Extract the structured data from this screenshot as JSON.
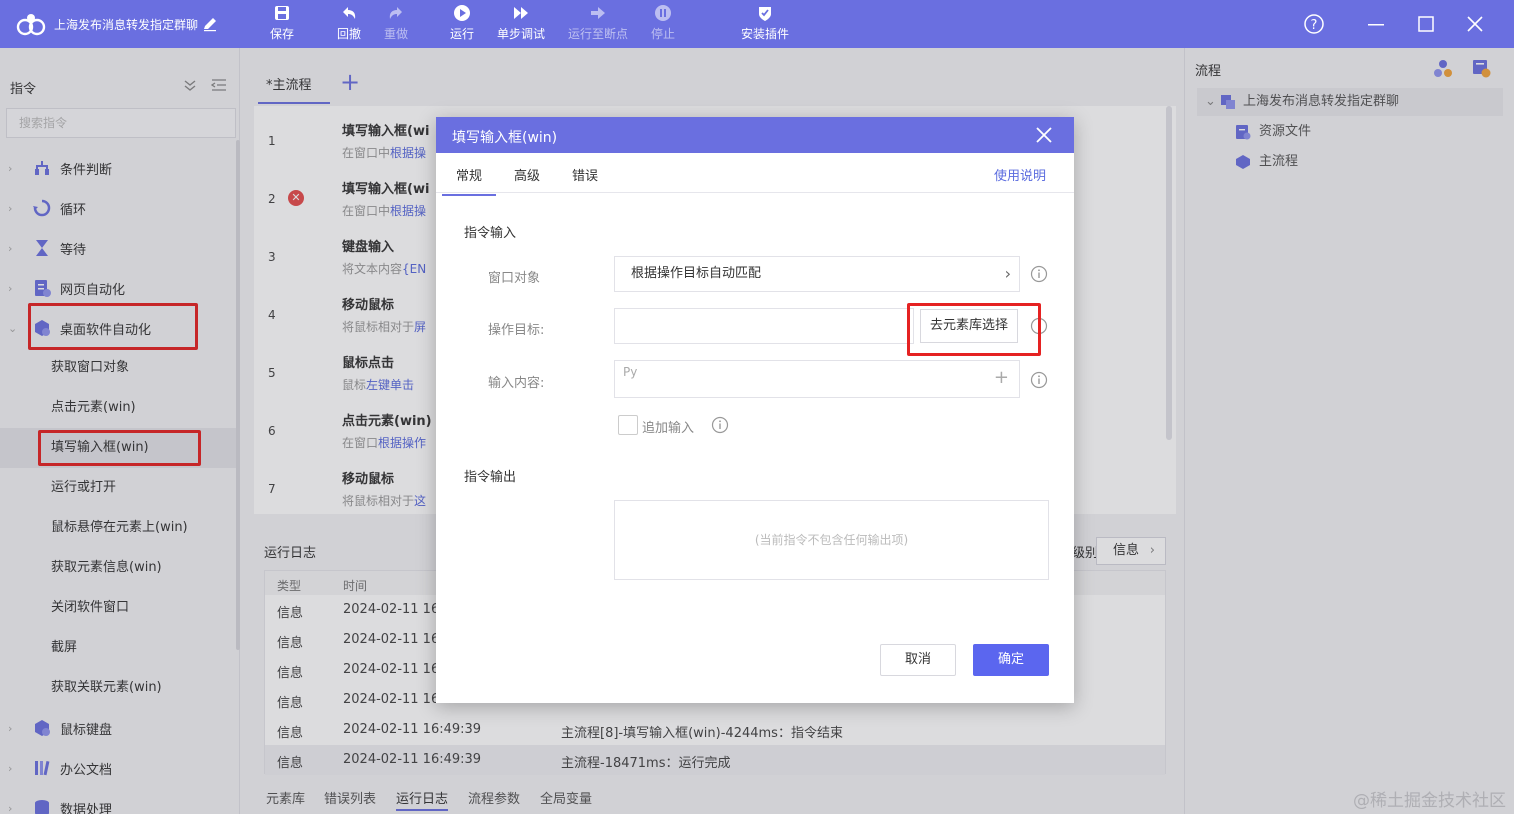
{
  "app": {
    "title": "上海发布消息转发指定群聊"
  },
  "toolbar": {
    "items": [
      {
        "label": "保存",
        "icon": "save-icon"
      },
      {
        "label": "回撤",
        "icon": "undo-icon"
      },
      {
        "label": "重做",
        "icon": "redo-icon"
      },
      {
        "label": "运行",
        "icon": "play-icon"
      },
      {
        "label": "单步调试",
        "icon": "step-debug-icon"
      },
      {
        "label": "运行至断点",
        "icon": "run-to-breakpoint-icon"
      },
      {
        "label": "停止",
        "icon": "stop-icon"
      },
      {
        "label": "安装插件",
        "icon": "plugin-icon"
      }
    ]
  },
  "left": {
    "title": "指令",
    "search_placeholder": "搜索指令",
    "categories": [
      {
        "label": "条件判断"
      },
      {
        "label": "循环"
      },
      {
        "label": "等待"
      },
      {
        "label": "网页自动化"
      },
      {
        "label": "桌面软件自动化"
      },
      {
        "label": "鼠标键盘"
      },
      {
        "label": "办公文档"
      },
      {
        "label": "数据处理"
      }
    ],
    "sub_items": [
      {
        "label": "获取窗口对象"
      },
      {
        "label": "点击元素(win)"
      },
      {
        "label": "填写输入框(win)"
      },
      {
        "label": "运行或打开"
      },
      {
        "label": "鼠标悬停在元素上(win)"
      },
      {
        "label": "获取元素信息(win)"
      },
      {
        "label": "关闭软件窗口"
      },
      {
        "label": "截屏"
      },
      {
        "label": "获取关联元素(win)"
      }
    ]
  },
  "flow": {
    "tab_label": "*主流程",
    "add_tab": "+",
    "rows": [
      {
        "num": "1",
        "title": "填写输入框(wi",
        "desc_prefix": "在窗口中",
        "desc_link": "根据操"
      },
      {
        "num": "2",
        "title": "填写输入框(wi",
        "desc_prefix": "在窗口中",
        "desc_link": "根据操"
      },
      {
        "num": "3",
        "title": "键盘输入",
        "desc_prefix": "将文本内容",
        "desc_link": "{EN"
      },
      {
        "num": "4",
        "title": "移动鼠标",
        "desc_prefix": "将鼠标相对于",
        "desc_link": "屏"
      },
      {
        "num": "5",
        "title": "鼠标点击",
        "desc_prefix": "鼠标",
        "desc_link": "左键单击"
      },
      {
        "num": "6",
        "title": "点击元素(win)",
        "desc_prefix": "在窗口",
        "desc_link": "根据操作"
      },
      {
        "num": "7",
        "title": "移动鼠标",
        "desc_prefix": "将鼠标相对于",
        "desc_link": "这"
      }
    ]
  },
  "log": {
    "title": "运行日志",
    "filter_label": "级别:",
    "filter_value": "信息",
    "columns": [
      "类型",
      "时间"
    ],
    "rows": [
      {
        "type": "信息",
        "time": "2024-02-11 16",
        "msg": ""
      },
      {
        "type": "信息",
        "time": "2024-02-11 16",
        "msg": ""
      },
      {
        "type": "信息",
        "time": "2024-02-11 16",
        "msg": ""
      },
      {
        "type": "信息",
        "time": "2024-02-11 16",
        "msg": ""
      },
      {
        "type": "信息",
        "time": "2024-02-11 16:49:39",
        "msg": "主流程[8]-填写输入框(win)-4244ms：指令结束"
      },
      {
        "type": "信息",
        "time": "2024-02-11 16:49:39",
        "msg": "主流程-18471ms：运行完成"
      }
    ]
  },
  "bottom_tabs": [
    {
      "label": "元素库"
    },
    {
      "label": "错误列表"
    },
    {
      "label": "运行日志"
    },
    {
      "label": "流程参数"
    },
    {
      "label": "全局变量"
    }
  ],
  "right": {
    "title": "流程",
    "root": "上海发布消息转发指定群聊",
    "nodes": [
      {
        "label": "资源文件"
      },
      {
        "label": "主流程"
      }
    ]
  },
  "dialog": {
    "title": "填写输入框(win)",
    "tabs": [
      {
        "label": "常规"
      },
      {
        "label": "高级"
      },
      {
        "label": "错误"
      }
    ],
    "help_link": "使用说明",
    "input_section": "指令输入",
    "fields": {
      "window_label": "窗口对象",
      "window_value": "根据操作目标自动匹配",
      "target_label": "操作目标:",
      "target_button": "去元素库选择",
      "content_label": "输入内容:",
      "content_prefix": "Py",
      "append_label": "追加输入"
    },
    "output_section": "指令输出",
    "output_empty": "(当前指令不包含任何输出项)",
    "cancel": "取消",
    "ok": "确定"
  },
  "watermark": "@稀土掘金技术社区",
  "colors": {
    "accent": "#6a6fe0",
    "primary_button": "#5b66ef",
    "highlight_box": "#e52222",
    "link": "#5a6bdf"
  }
}
